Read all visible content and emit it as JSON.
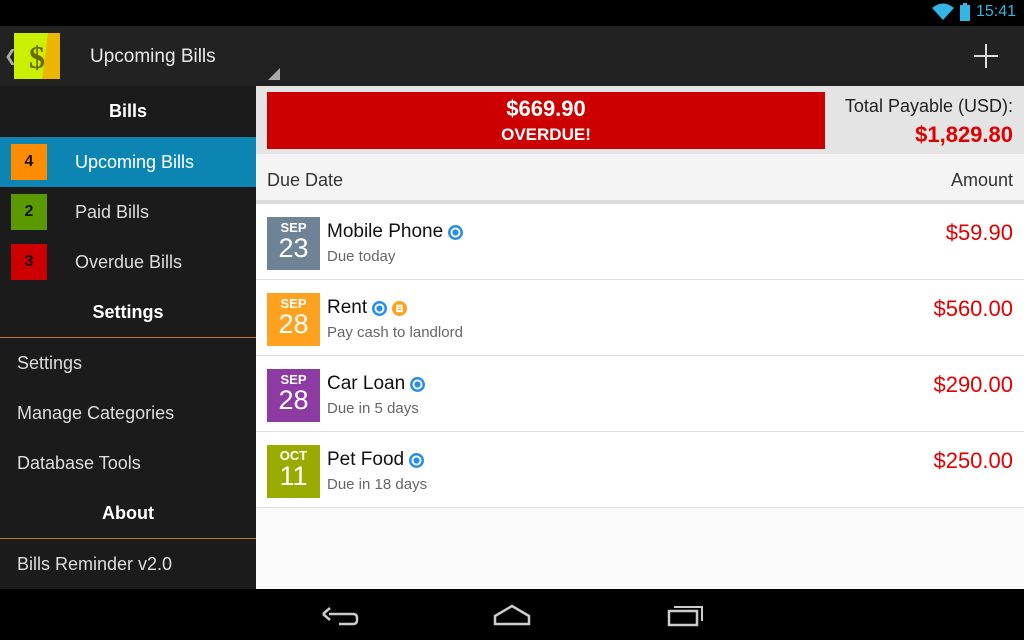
{
  "status_bar": {
    "time": "15:41"
  },
  "action_bar": {
    "title": "Upcoming Bills",
    "app_icon": "dollar-icon",
    "add_icon": "plus-icon"
  },
  "sidebar": {
    "bills_header": "Bills",
    "bill_items": [
      {
        "count": "4",
        "label": "Upcoming Bills",
        "color": "#ff8c00",
        "active": true
      },
      {
        "count": "2",
        "label": "Paid Bills",
        "color": "#5a9a00",
        "active": false
      },
      {
        "count": "3",
        "label": "Overdue Bills",
        "color": "#cc0000",
        "active": false
      }
    ],
    "settings_header": "Settings",
    "settings_items": [
      "Settings",
      "Manage Categories",
      "Database Tools"
    ],
    "about_header": "About",
    "about_items": [
      "Bills Reminder v2.0"
    ],
    "active_color": "#0c85b3"
  },
  "summary": {
    "overdue_amount": "$669.90",
    "overdue_label": "OVERDUE!",
    "total_label": "Total Payable (USD):",
    "total_amount": "$1,829.80"
  },
  "columns": {
    "due_date": "Due Date",
    "amount": "Amount"
  },
  "bills": [
    {
      "month": "SEP",
      "day": "23",
      "color": "#6f8397",
      "name": "Mobile Phone",
      "subtitle": "Due today",
      "amount": "$59.90",
      "icons": [
        "recurring-icon"
      ]
    },
    {
      "month": "SEP",
      "day": "28",
      "color": "#ffa21f",
      "name": "Rent",
      "subtitle": "Pay cash to landlord",
      "amount": "$560.00",
      "icons": [
        "recurring-icon",
        "note-icon"
      ]
    },
    {
      "month": "SEP",
      "day": "28",
      "color": "#8e3aa3",
      "name": "Car Loan",
      "subtitle": "Due in 5 days",
      "amount": "$290.00",
      "icons": [
        "recurring-icon"
      ]
    },
    {
      "month": "OCT",
      "day": "11",
      "color": "#9aab00",
      "name": "Pet Food",
      "subtitle": "Due in 18 days",
      "amount": "$250.00",
      "icons": [
        "recurring-icon"
      ]
    }
  ],
  "nav_bar": {
    "icons": [
      "back-icon",
      "home-icon",
      "recents-icon"
    ]
  }
}
